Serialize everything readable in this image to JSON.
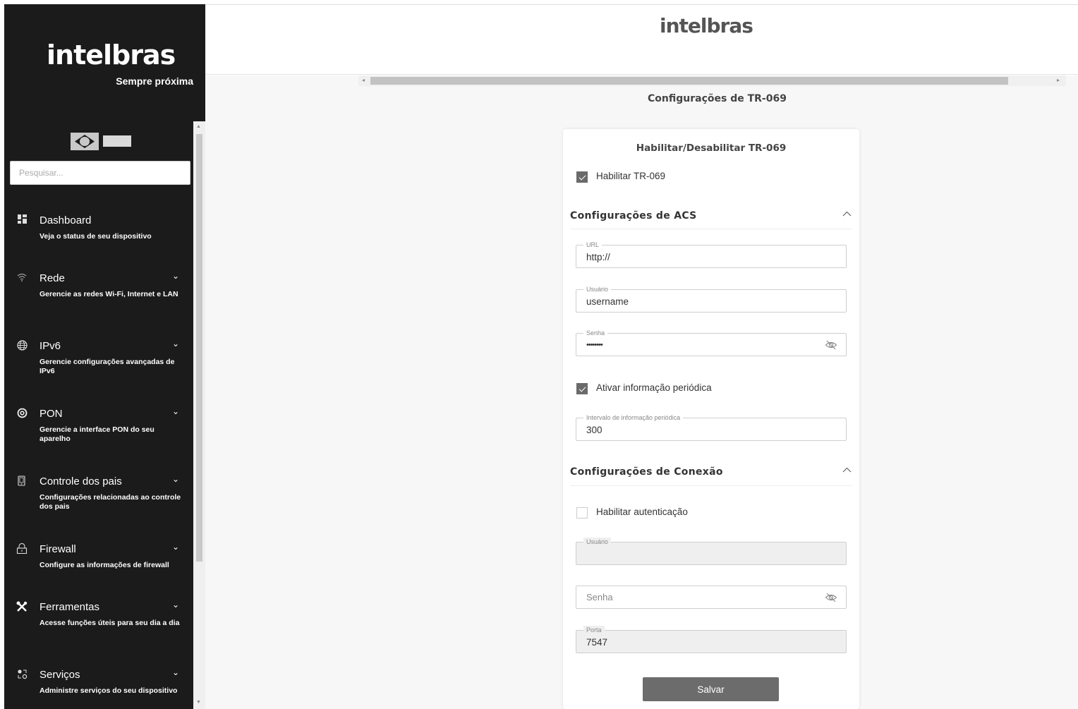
{
  "sidebar": {
    "logo": "intelbras",
    "tagline": "Sempre próxima",
    "search_placeholder": "Pesquisar...",
    "items": [
      {
        "icon": "dashboard-icon",
        "title": "Dashboard",
        "desc": "Veja o status de seu dispositivo"
      },
      {
        "icon": "wifi-icon",
        "title": "Rede",
        "desc": "Gerencie as redes Wi-Fi, Internet e LAN"
      },
      {
        "icon": "globe-icon",
        "title": "IPv6",
        "desc": "Gerencie configurações avançadas de IPv6"
      },
      {
        "icon": "pon-icon",
        "title": "PON",
        "desc": "Gerencie a interface PON do seu aparelho"
      },
      {
        "icon": "parental-control-icon",
        "title": "Controle dos pais",
        "desc": "Configurações relacionadas ao controle dos pais"
      },
      {
        "icon": "lock-icon",
        "title": "Firewall",
        "desc": "Configure as informações de firewall"
      },
      {
        "icon": "tools-icon",
        "title": "Ferramentas",
        "desc": "Acesse funções úteis para seu dia a dia"
      },
      {
        "icon": "services-icon",
        "title": "Serviços",
        "desc": "Administre serviços do seu dispositivo"
      }
    ]
  },
  "header": {
    "logo": "intelbras"
  },
  "page_title": "Configurações de TR-069",
  "card": {
    "title": "Habilitar/Desabilitar TR-069",
    "enable_tr069": {
      "label": "Habilitar TR-069",
      "checked": true
    },
    "acs": {
      "title": "Configurações de ACS",
      "url": {
        "label": "URL",
        "value": "http://"
      },
      "user": {
        "label": "Usuário",
        "value": "username"
      },
      "password": {
        "label": "Senha",
        "value": "••••••••"
      },
      "periodic": {
        "label": "Ativar informação periódica",
        "checked": true
      },
      "interval": {
        "label": "Intervalo de informação periódica",
        "value": "300"
      }
    },
    "connection": {
      "title": "Configurações de Conexão",
      "auth": {
        "label": "Habilitar autenticação",
        "checked": false
      },
      "user": {
        "label": "Usuário",
        "value": ""
      },
      "password": {
        "placeholder": "Senha"
      },
      "port": {
        "label": "Porta",
        "value": "7547"
      }
    },
    "save_label": "Salvar"
  }
}
